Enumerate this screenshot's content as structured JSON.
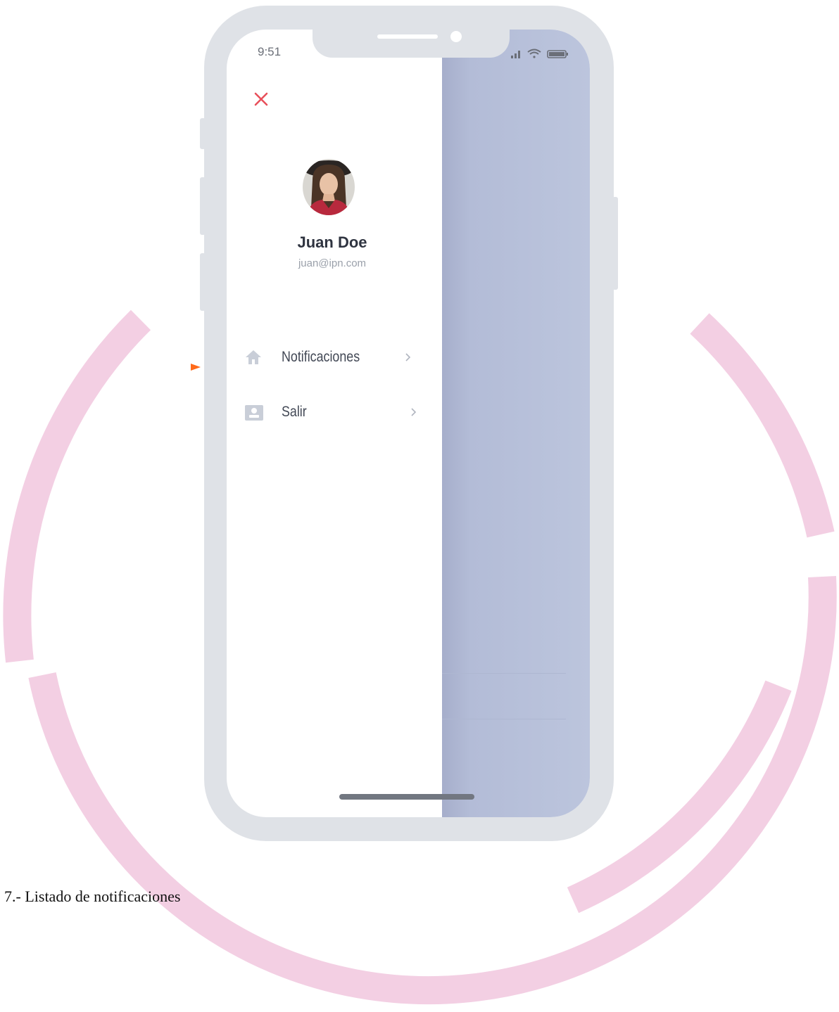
{
  "status_bar": {
    "time": "9:51"
  },
  "user": {
    "name": "Juan Doe",
    "email": "juan@ipn.com"
  },
  "menu": {
    "items": [
      {
        "label": "Notificaciones",
        "icon": "home-icon"
      },
      {
        "label": "Salir",
        "icon": "contact-card-icon"
      }
    ]
  },
  "caption": "7.- Listado de notificaciones",
  "colors": {
    "ring": "#f3cfe3",
    "phone_frame": "#dfe2e7",
    "overlay": "#bcc5dd",
    "close_icon": "#e8505b",
    "pointer": "#ff6a1a"
  },
  "icons": {
    "close": "close-icon",
    "chevron": "chevron-right-icon",
    "signal": "signal-icon",
    "wifi": "wifi-icon",
    "battery": "battery-icon"
  }
}
